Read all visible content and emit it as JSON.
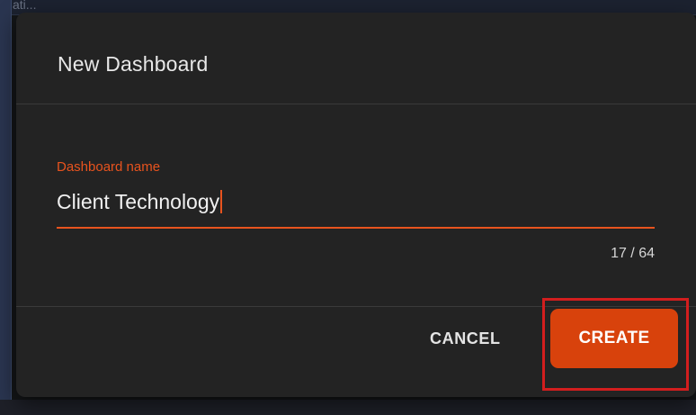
{
  "background": {
    "fragment_text": "ati..."
  },
  "dialog": {
    "title": "New Dashboard",
    "field": {
      "label": "Dashboard name",
      "value": "Client Technology",
      "counter": "17 / 64",
      "max_length": 64,
      "current_length": 17
    },
    "actions": {
      "cancel_label": "CANCEL",
      "create_label": "CREATE"
    }
  },
  "colors": {
    "accent": "#d8420c",
    "label": "#e8531e",
    "highlight": "#d21e1e",
    "dialog_bg": "#232323"
  }
}
